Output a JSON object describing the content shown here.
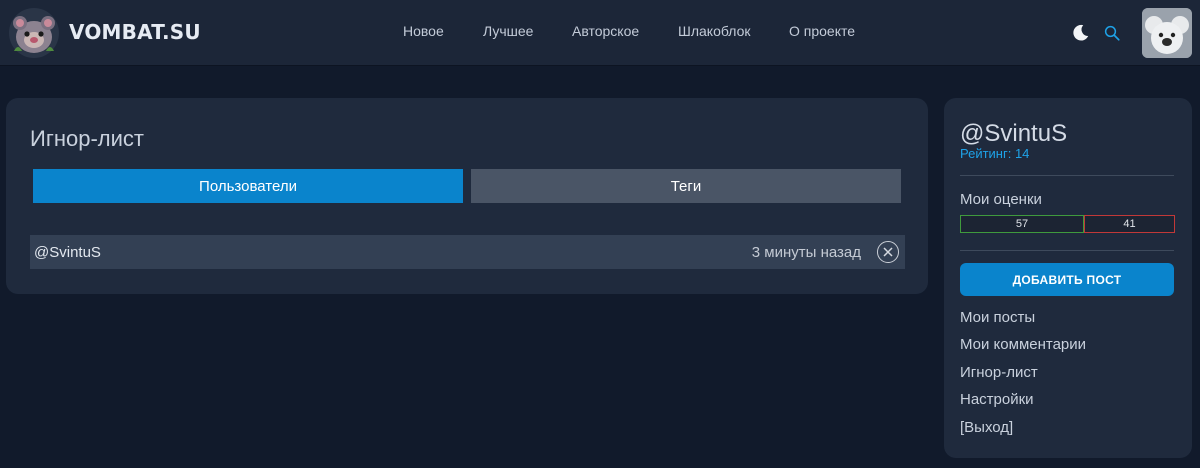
{
  "header": {
    "brand": "VOMBAT.SU",
    "nav": [
      "Новое",
      "Лучшее",
      "Авторское",
      "Шлакоблок",
      "О проекте"
    ],
    "icons": {
      "theme": "moon-icon",
      "search": "search-icon"
    },
    "colors": {
      "header_bg": "#1c2638",
      "accent": "#1ea2e8"
    }
  },
  "main": {
    "title": "Игнор-лист",
    "tabs": [
      {
        "label": "Пользователи",
        "active": true
      },
      {
        "label": "Теги",
        "active": false
      }
    ],
    "ignore_list": [
      {
        "user": "@SvintuS",
        "time": "3 минуты назад",
        "remove_icon": "close-circle-icon"
      }
    ]
  },
  "sidebar": {
    "username": "@SvintuS",
    "rating": "Рейтинг: 14",
    "votes_label": "Мои оценки",
    "votes_up": "57",
    "votes_down": "41",
    "add_post": "ДОБАВИТЬ ПОСТ",
    "menu": [
      "Мои посты",
      "Мои комментарии",
      "Игнор-лист",
      "Настройки",
      "[Выход]"
    ],
    "colors": {
      "primary": "#0a84cc",
      "up": "#3f9a3d",
      "down": "#c13838"
    }
  }
}
